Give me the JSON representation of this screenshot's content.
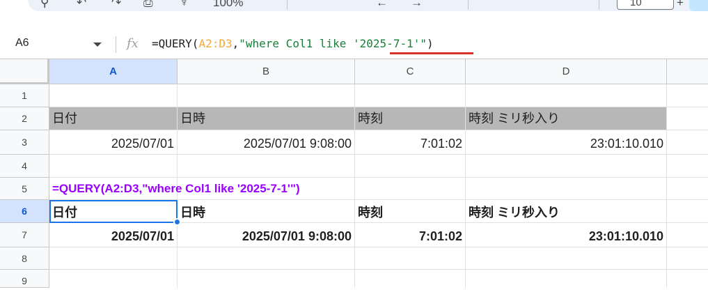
{
  "toolbar": {
    "zoom": "100%",
    "font_size": "10"
  },
  "formula_bar": {
    "name_box": "A6",
    "fx_label": "fx",
    "formula_prefix": "=QUERY(",
    "formula_range": "A2:D3",
    "formula_comma": ",",
    "formula_string_start": "\"where Col1 like ",
    "formula_string_quoted": "'2025-7-1'",
    "formula_string_end": "\"",
    "formula_close": ")"
  },
  "columns": [
    "A",
    "B",
    "C",
    "D"
  ],
  "rows": [
    "1",
    "2",
    "3",
    "4",
    "5",
    "6",
    "7",
    "8",
    "9"
  ],
  "sheet": {
    "header_row": [
      "日付",
      "日時",
      "時刻",
      "時刻 ミリ秒入り"
    ],
    "data_row": [
      "2025/07/01",
      "2025/07/01 9:08:00",
      "7:01:02",
      "23:01:10.010"
    ],
    "formula_note": "=QUERY(A2:D3,\"where Col1 like '2025-7-1'\")",
    "result_header": [
      "日付",
      "日時",
      "時刻",
      "時刻 ミリ秒入り"
    ],
    "result_row": [
      "2025/07/01",
      "2025/07/01 9:08:00",
      "7:01:02",
      "23:01:10.010"
    ]
  },
  "colors": {
    "header_fill": "#b7b7b7",
    "note_text": "#9900ff",
    "selection": "#1a73e8",
    "underline": "#d93025"
  }
}
